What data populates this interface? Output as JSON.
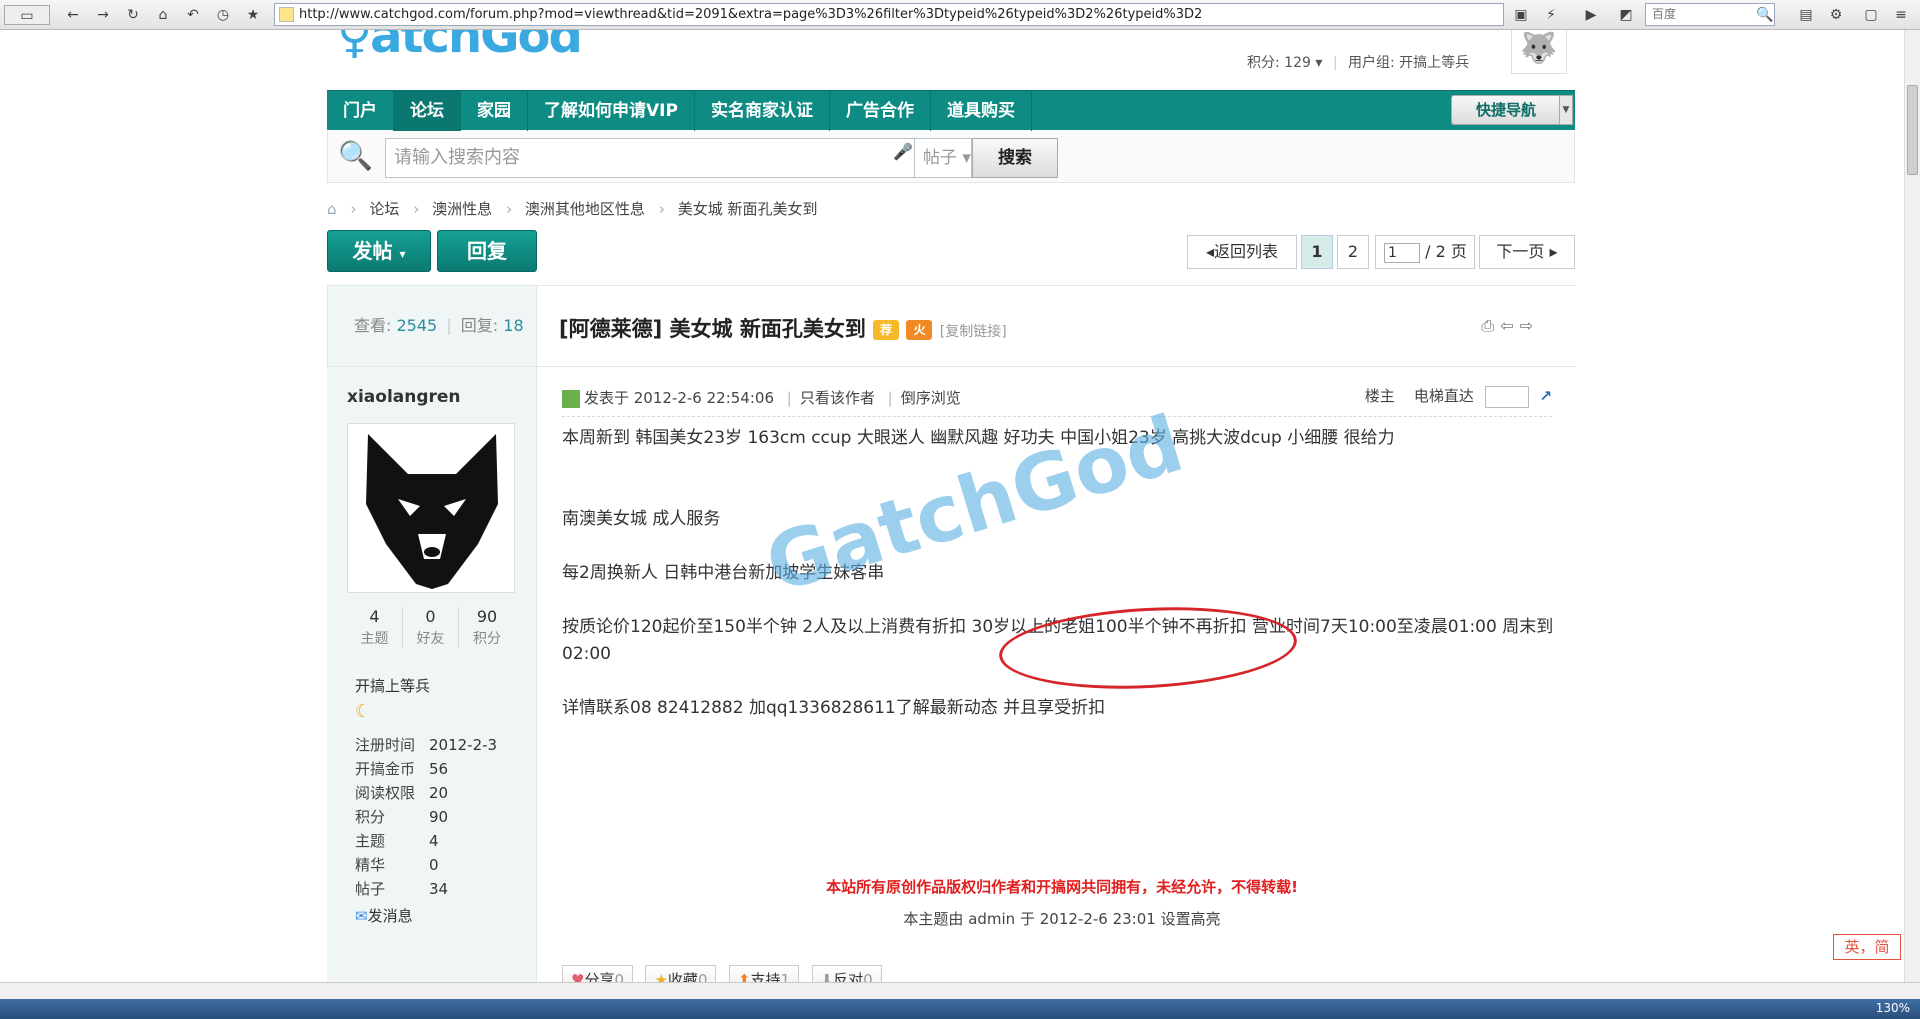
{
  "browser": {
    "url": "http://www.catchgod.com/forum.php?mod=viewthread&tid=2091&extra=page%3D3%26filter%3Dtypeid%26typeid%3D2%26typeid%3D2",
    "search_placeholder": "百度",
    "zoom": "130%"
  },
  "header": {
    "logo": "atchGod",
    "points_label": "积分: 129",
    "usergroup_label": "用户组: 开搞上等兵"
  },
  "nav": {
    "items": [
      "门户",
      "论坛",
      "家园",
      "了解如何申请VIP",
      "实名商家认证",
      "广告合作",
      "道具购买"
    ],
    "active": "论坛",
    "quick": "快捷导航"
  },
  "search": {
    "placeholder": "请输入搜索内容",
    "type": "帖子",
    "button": "搜索"
  },
  "breadcrumb": [
    "论坛",
    "澳洲性息",
    "澳洲其他地区性息",
    "美女城 新面孔美女到"
  ],
  "actions": {
    "post": "发帖",
    "reply": "回复"
  },
  "pager": {
    "back": "返回列表",
    "pages": [
      "1",
      "2"
    ],
    "current": "1",
    "input": "1",
    "total": "/ 2 页",
    "next": "下一页"
  },
  "thread": {
    "views_label": "查看:",
    "views": "2545",
    "replies_label": "回复:",
    "replies": "18",
    "title": "[阿德莱德] 美女城 新面孔美女到",
    "copy_link": "[复制链接]"
  },
  "author": {
    "name": "xiaolangren",
    "stats": [
      {
        "value": "4",
        "label": "主题"
      },
      {
        "value": "0",
        "label": "好友"
      },
      {
        "value": "90",
        "label": "积分"
      }
    ],
    "rank": "开搞上等兵",
    "details": [
      {
        "k": "注册时间",
        "v": "2012-2-3"
      },
      {
        "k": "开搞金币",
        "v": "56"
      },
      {
        "k": "阅读权限",
        "v": "20"
      },
      {
        "k": "积分",
        "v": "90"
      },
      {
        "k": "主题",
        "v": "4"
      },
      {
        "k": "精华",
        "v": "0"
      },
      {
        "k": "帖子",
        "v": "34"
      }
    ],
    "message": "发消息"
  },
  "post": {
    "posted": "发表于 2012-2-6 22:54:06",
    "only_author": "只看该作者",
    "reverse": "倒序浏览",
    "floor": "楼主",
    "elevator": "电梯直达",
    "lines": [
      "本周新到 韩国美女23岁 163cm ccup  大眼迷人 幽默风趣 好功夫    中国小姐23岁 高挑大波dcup  小细腰 很给力",
      "",
      "",
      "南澳美女城 成人服务",
      "",
      "每2周换新人 日韩中港台新加坡学生妹客串",
      "",
      "按质论价120起价至150半个钟   2人及以上消费有折扣  30岁以上的老姐100半个钟不再折扣  营业时间7天10:00至凌晨01:00 周末到02:00",
      "",
      "详情联系08 82412882 加qq1336828611了解最新动态 并且享受折扣"
    ],
    "notice": "本站所有原创作品版权归作者和开搞网共同拥有，未经允许，不得转载!",
    "highlight": "本主题由 admin 于 2012-2-6 23:01 设置高亮"
  },
  "watermark": "GatchGod",
  "bottom_actions": [
    {
      "label": "分享",
      "count": "0"
    },
    {
      "label": "收藏",
      "count": "0"
    },
    {
      "label": "支持",
      "count": "1"
    },
    {
      "label": "反对",
      "count": "0"
    }
  ],
  "ime": "英，简",
  "colors": {
    "nav": "#0e8b83",
    "accent": "#2d8c9f",
    "notice": "#e02020",
    "circle": "#d6262a"
  }
}
